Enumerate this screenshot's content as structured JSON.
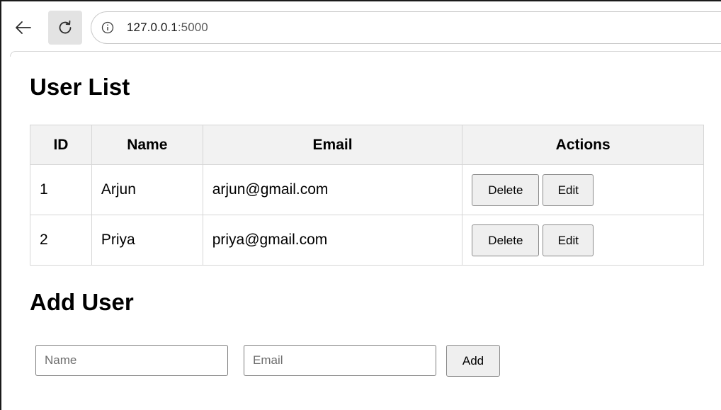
{
  "browser": {
    "url_host": "127.0.0.1",
    "url_port": ":5000",
    "icons": {
      "back": "arrow-left-icon",
      "reload": "reload-icon",
      "info": "info-icon"
    }
  },
  "page": {
    "users_title": "User List",
    "add_title": "Add User"
  },
  "table": {
    "headers": [
      "ID",
      "Name",
      "Email",
      "Actions"
    ],
    "rows": [
      {
        "id": "1",
        "name": "Arjun",
        "email": "arjun@gmail.com",
        "delete_label": "Delete",
        "edit_label": "Edit"
      },
      {
        "id": "2",
        "name": "Priya",
        "email": "priya@gmail.com",
        "delete_label": "Delete",
        "edit_label": "Edit"
      }
    ]
  },
  "form": {
    "name_placeholder": "Name",
    "name_value": "",
    "email_placeholder": "Email",
    "email_value": "",
    "add_label": "Add"
  }
}
